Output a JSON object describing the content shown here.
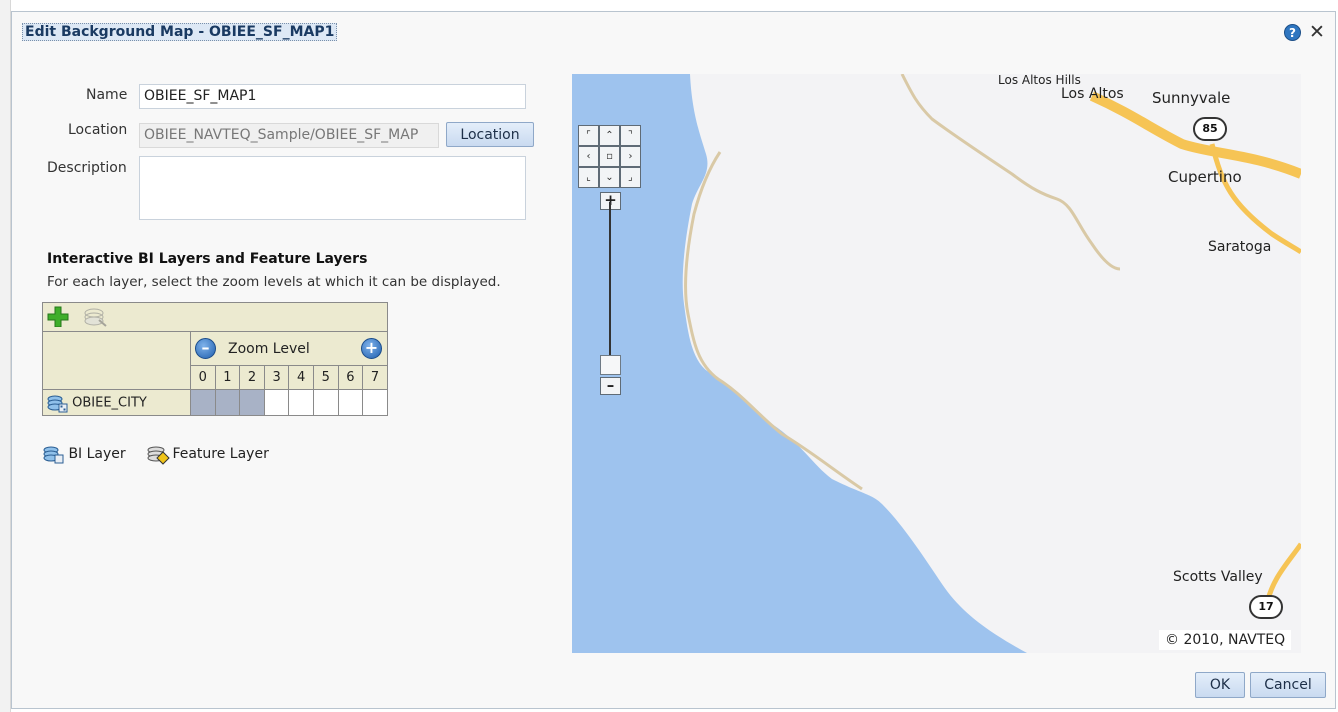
{
  "dialog": {
    "title": "Edit Background Map - OBIEE_SF_MAP1",
    "help_icon": "question-circle-icon",
    "close_icon": "close-icon"
  },
  "form": {
    "name_label": "Name",
    "name_value": "OBIEE_SF_MAP1",
    "location_label": "Location",
    "location_value": "OBIEE_NAVTEQ_Sample/OBIEE_SF_MAP",
    "location_button": "Location",
    "description_label": "Description",
    "description_value": ""
  },
  "layers": {
    "section_title": "Interactive BI Layers and Feature Layers",
    "section_desc": "For each layer, select the zoom levels at which it can be displayed.",
    "zoom_header": "Zoom Level",
    "zoom_levels": [
      "0",
      "1",
      "2",
      "3",
      "4",
      "5",
      "6",
      "7"
    ],
    "rows": [
      {
        "name": "OBIEE_CITY",
        "type": "bi-layer",
        "selected_levels": [
          0,
          1,
          2
        ]
      }
    ],
    "legend_bi": "BI Layer",
    "legend_feature": "Feature Layer"
  },
  "map": {
    "labels": [
      "Los Altos Hills",
      "Los Altos",
      "Sunnyvale",
      "Cupertino",
      "Saratoga",
      "Scotts Valley"
    ],
    "shields": [
      "85",
      "17"
    ],
    "copyright": "© 2010, NAVTEQ",
    "colors": {
      "water": "#9ec3ee",
      "land": "#f3f3f5",
      "road_major": "#f6c455",
      "road_minor": "#d9c9a6"
    }
  },
  "footer": {
    "ok_label": "OK",
    "cancel_label": "Cancel"
  }
}
